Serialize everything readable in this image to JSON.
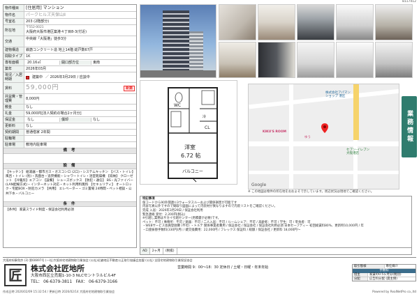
{
  "sheet_id": "8117412",
  "info": {
    "type_label": "物件種目",
    "type_value": "[住居用] マンション",
    "name_label": "物件名",
    "name_value": "パークヒルズ天保山Ⅱ",
    "room_label": "号室名",
    "room_value": "203 (2階部分)",
    "addr_label": "所在地",
    "zip": "〒552-0021",
    "addr_value": "大阪府大阪市港区築港４丁目8-3(付近)",
    "traffic_label": "交通",
    "traffic_value": "中央線「大阪港」徒歩3分",
    "structure_label": "建物構造",
    "structure_value": "鉄筋コンクリート造 地上14階 総戸数67戸",
    "layout_label": "間取タイプ",
    "layout_value": "1K",
    "area_label": "専有面積",
    "area_value": "20.16㎡",
    "dir_label": "開口部方位",
    "dir_value": "東南",
    "built_label": "築年",
    "built_value": "2026年03月",
    "move_label": "現況／入居時期",
    "move_status": "建築中",
    "move_date": "／ 2026年3月29日 / 应談中",
    "rent_label": "賃料",
    "rent_value": "59,000円",
    "new_badge": "新築",
    "mgmt_label": "共益費・管理費",
    "mgmt_value": "8,000円",
    "deposit_label": "敷金",
    "deposit_value": "なし",
    "keymoney_label": "礼金",
    "keymoney_value": "59,000円[法人契約の場合2ヶ月分]",
    "hoshokin_label": "保証金",
    "hoshokin_value": "なし",
    "shokyaku_label": "償却",
    "shokyaku_value": "なし",
    "renew_label": "更新料",
    "renew_value": "なし",
    "contract_label": "契約期間",
    "contract_value": "普通借家 2年間",
    "parking_room_label": "駐輪場",
    "parking_room_value": "",
    "bike_label": "駐車場",
    "bike_value": "敷地内駐車場",
    "notes_header": "備 考",
    "equip_header": "設 備",
    "equip_text": "【キッチン】 給湯器・都市ガス・ガスコンロ (2口)・システムキッチン 【バス・トイレ】風呂・トイレ (別)・洗面台・追焚機能・シャワートイレ・浴室乾燥機 【収納】 クローゼット 【冷暖房】エアコン 【設備】 シューズボックス 【防犯・通信】 BS・光ファイバー (LAN配線方式)・インターネット対応・ネット利用料無料 【セキュリティ】 オートロック・宅配BOX・防犯カメラ 【共用】 エレベーター・ゴミ置場 24時間・ペット相談・公共下水・バルコニー",
    "conditions_header": "条 件",
    "conditions_text": "【条件】 家賃スライド制度・保証会社利用必須"
  },
  "map": {
    "company_label": "株式会社アパマン",
    "company_sub": "ショップ 港区",
    "shop_label": "KIKU'S ROOM",
    "station_label": "ゆう",
    "seven": "セブン-イレブン",
    "seven_sub": "大阪港店",
    "google": "Google",
    "note": "※ この地図は物件の所在地をおおよそで示しています。周辺状況は現地でご確認ください。"
  },
  "side_label": "業務情報",
  "remarks": [
    "特記事項",
    "保コードから90外関連①3ウォータスル一および関係損害が可能です",
    "内容写真以外ですので間取り図面によって内装材が異なりますので内装リストをご確認ください。",
    "完成 入居：2026年3月29日 / 保証会社利用",
    "緊急連絡 受付：2,200円(税込)",
    "※引越し業務はサカイ引越センター(見積書が必要)です。",
    "ペット：不可 / 事務所：不可 / 楽器：不可 / 二人入居：不可 / ルームシェア：不可 / 高齢者：不可 / 学生：可 / 単身者：可",
    "・WEBサービス会員登録費 (不可) ・トルテ 関係事業者費用 / 保証会社 / 保証会社 / 保証会社利用必須 日本セーフティー 初回総賃料80%、更新時10,000円 / 年",
    "・口座振替手数料(330円/月) / 鍵交換費用：22,000円 / フレックス 保証料 / 総額 / 保証会社 / 更新料 18,000円～"
  ],
  "bottombar": {
    "label": "AD",
    "value": "2ヶ月",
    "note": "(税抜)"
  },
  "license": "大阪府知事免許 (3) 第60897号 (一社)大阪府宅地建物取引業協会 (公社)近畿地区不動産公正取引協議会加盟 (公社) 全国宅地建物取引業保証協会",
  "company": {
    "logo": "匠",
    "name": "株式会社匠地所",
    "addr": "大阪市西区立売堀1-10-3 NLCセントラルビル4F",
    "tel": "TEL： 06-6379-3811",
    "fax": "FAX： 06-6379-3166",
    "hours": "営業時間 9：00〜18：30 定休日 / 土曜・日曜・年末年始"
  },
  "fee": {
    "h1": "取引態様",
    "h1v": "専任媒介",
    "band": "手数料",
    "r1k": "借主",
    "r1v": "家賃の0.5ヶ月分(税別)",
    "r2k": "分配",
    "r2v": "広告料分配 (貸主側)"
  },
  "footer": {
    "left": "作成日時 2026/02/09 15:32:54 / 更新日時 2026/02/14 大阪府宅地建物取引業協会 ",
    "right": "Powered by RealNetPro co.,ltd"
  }
}
